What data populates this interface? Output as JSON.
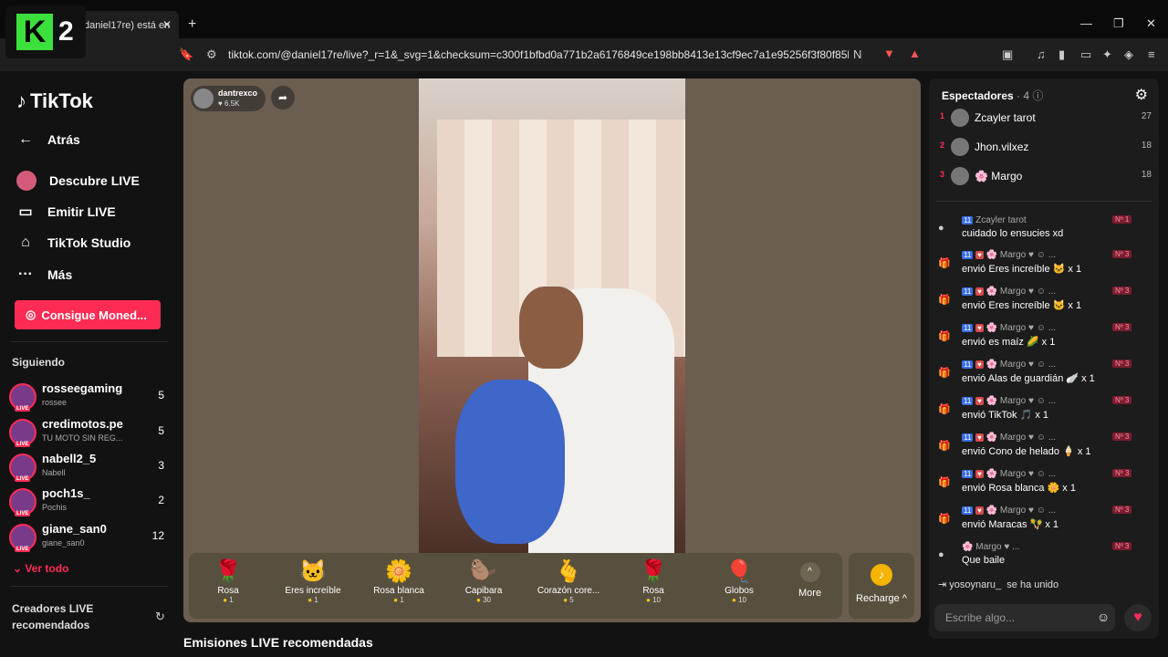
{
  "browser": {
    "tab_title": "daniel17re) está en",
    "url": "tiktok.com/@daniel17re/live?_r=1&_svg=1&checksum=c300f1bfbd0a771b2a6176849ce198bb8413e13cf9ec7a1e95256f3f80f85b1f&en..."
  },
  "overlay": {
    "logo_k": "K",
    "logo_2": "2"
  },
  "sidebar": {
    "logo": "TikTok",
    "nav": [
      {
        "label": "Atrás",
        "icon": "arrow-left-icon"
      },
      {
        "label": "Descubre LIVE",
        "icon": "live-avatar-icon"
      },
      {
        "label": "Emitir LIVE",
        "icon": "video-camera-icon"
      },
      {
        "label": "TikTok Studio",
        "icon": "home-icon"
      },
      {
        "label": "Más",
        "icon": "more-dots-icon"
      }
    ],
    "coins_button": "Consigue Moned...",
    "following_title": "Siguiendo",
    "following": [
      {
        "name": "rosseegaming",
        "sub": "rossee",
        "count": "5"
      },
      {
        "name": "credimotos.pe",
        "sub": "TU MOTO SIN REG...",
        "count": "5"
      },
      {
        "name": "nabell2_5",
        "sub": "Nabell",
        "count": "3"
      },
      {
        "name": "poch1s_",
        "sub": "Pochis",
        "count": "2"
      },
      {
        "name": "giane_san0",
        "sub": "giane_san0",
        "count": "12"
      }
    ],
    "see_all": "Ver todo",
    "creators_title_1": "Creadores LIVE",
    "creators_title_2": "recomendados"
  },
  "live": {
    "host_name": "dantrexco",
    "host_likes": "6.5K",
    "gifts": [
      {
        "name": "Rosa",
        "price": "1",
        "icon": "rose-icon"
      },
      {
        "name": "Eres increíble",
        "price": "1",
        "icon": "cat-icon"
      },
      {
        "name": "Rosa blanca",
        "price": "1",
        "icon": "white-rose-icon"
      },
      {
        "name": "Capibara",
        "price": "30",
        "icon": "capybara-icon"
      },
      {
        "name": "Corazón core...",
        "price": "5",
        "icon": "finger-heart-icon"
      },
      {
        "name": "Rosa",
        "price": "10",
        "icon": "rose-icon"
      },
      {
        "name": "Globos",
        "price": "10",
        "icon": "balloons-icon"
      }
    ],
    "more_label": "More",
    "recharge_label": "Recharge"
  },
  "recommended_title": "Emisiones LIVE recomendadas",
  "chat": {
    "viewers_title": "Espectadores",
    "viewers_count": "· 4",
    "viewers": [
      {
        "rank": "1",
        "name": "Zcayler tarot",
        "score": "27"
      },
      {
        "rank": "2",
        "name": "Jhon.vilxez",
        "score": "18"
      },
      {
        "rank": "3",
        "name": "🌸 Margo",
        "score": "18"
      }
    ],
    "messages": [
      {
        "user": "Zcayler tarot",
        "badge": "11",
        "rank": "Nº 1",
        "text": "cuidado lo ensucies xd"
      },
      {
        "user": "Margo",
        "badge": "11",
        "rank": "Nº 3",
        "text": "envió Eres increíble 🐱 x 1"
      },
      {
        "user": "Margo",
        "badge": "11",
        "rank": "Nº 3",
        "text": "envió Eres increíble 🐱 x 1"
      },
      {
        "user": "Margo",
        "badge": "11",
        "rank": "Nº 3",
        "text": "envió es maíz 🌽 x 1"
      },
      {
        "user": "Margo",
        "badge": "11",
        "rank": "Nº 3",
        "text": "envió Alas de guardián 🪽 x 1"
      },
      {
        "user": "Margo",
        "badge": "11",
        "rank": "Nº 3",
        "text": "envió TikTok 🎵 x 1"
      },
      {
        "user": "Margo",
        "badge": "11",
        "rank": "Nº 3",
        "text": "envió Cono de helado 🍦 x 1"
      },
      {
        "user": "Margo",
        "badge": "11",
        "rank": "Nº 3",
        "text": "envió Rosa blanca 🌼 x 1"
      },
      {
        "user": "Margo",
        "badge": "11",
        "rank": "Nº 3",
        "text": "envió Maracas 🪇 x 1"
      },
      {
        "user": "Margo",
        "badge": "",
        "rank": "Nº 3",
        "text": "Que baile"
      }
    ],
    "joined_user": "yosoynaru_",
    "joined_text": "se ha unido",
    "input_placeholder": "Escribe algo..."
  }
}
